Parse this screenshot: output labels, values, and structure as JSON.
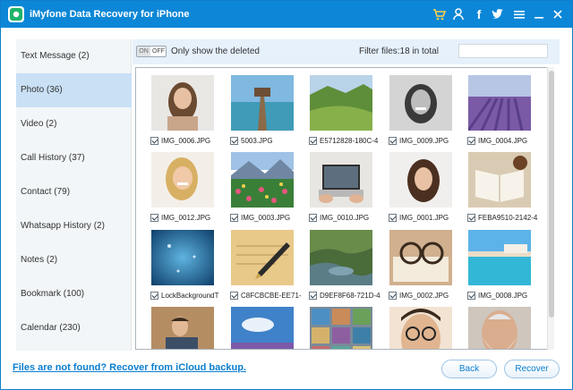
{
  "window": {
    "title": "iMyfone Data Recovery for iPhone",
    "accent": "#0c87d7",
    "icons": [
      "cart-icon",
      "user-key-icon",
      "facebook-icon",
      "twitter-icon",
      "menu-icon",
      "minimize-icon",
      "close-icon"
    ]
  },
  "sidebar": {
    "items": [
      {
        "label": "Text Message  (2)"
      },
      {
        "label": "Photo  (36)",
        "active": true
      },
      {
        "label": "Video  (2)"
      },
      {
        "label": "Call History  (37)"
      },
      {
        "label": "Contact  (79)"
      },
      {
        "label": "Whatsapp History  (2)"
      },
      {
        "label": "Notes  (2)"
      },
      {
        "label": "Bookmark  (100)"
      },
      {
        "label": "Calendar  (230)"
      }
    ]
  },
  "filterbar": {
    "toggle_on": "ON",
    "toggle_off": "OFF",
    "only_deleted_label": "Only show the deleted",
    "filter_count": "Filter files:18 in total",
    "search_value": ""
  },
  "photos": [
    {
      "name": "IMG_0006.JPG",
      "checked": true,
      "image": "portrait-woman-long-hair"
    },
    {
      "name": "5003.JPG",
      "checked": true,
      "image": "wooden-pier-sea"
    },
    {
      "name": "E5712828-180C-4",
      "checked": true,
      "image": "green-valley-landscape"
    },
    {
      "name": "IMG_0009.JPG",
      "checked": true,
      "image": "black-white-portrait-smiling"
    },
    {
      "name": "IMG_0004.JPG",
      "checked": true,
      "image": "lavender-field"
    },
    {
      "name": "IMG_0012.JPG",
      "checked": true,
      "image": "blonde-woman-smiling"
    },
    {
      "name": "IMG_0003.JPG",
      "checked": true,
      "image": "flower-field-mountains"
    },
    {
      "name": "IMG_0010.JPG",
      "checked": true,
      "image": "hands-on-laptop"
    },
    {
      "name": "IMG_0001.JPG",
      "checked": true,
      "image": "woman-portrait-dark-hair"
    },
    {
      "name": "FEBA9510-2142-4",
      "checked": true,
      "image": "open-book-coffee"
    },
    {
      "name": "LockBackgroundT",
      "checked": true,
      "image": "blue-abstract-background"
    },
    {
      "name": "C8FCBCBE-EE71-",
      "checked": true,
      "image": "fountain-pen-writing"
    },
    {
      "name": "D9EF8F68-721D-4",
      "checked": true,
      "image": "river-canyon"
    },
    {
      "name": "IMG_0002.JPG",
      "checked": true,
      "image": "glasses-on-book"
    },
    {
      "name": "IMG_0008.JPG",
      "checked": true,
      "image": "resort-pool"
    },
    {
      "name": "",
      "checked": false,
      "image": "man-reading-at-desk"
    },
    {
      "name": "",
      "checked": false,
      "image": "sky-lavender-field"
    },
    {
      "name": "",
      "checked": false,
      "image": "photo-collage"
    },
    {
      "name": "",
      "checked": false,
      "image": "man-with-glasses"
    },
    {
      "name": "",
      "checked": false,
      "image": "old-man-white-beard"
    }
  ],
  "footer": {
    "icloud_link": "Files are not found? Recover from iCloud backup.",
    "back_label": "Back",
    "recover_label": "Recover"
  }
}
